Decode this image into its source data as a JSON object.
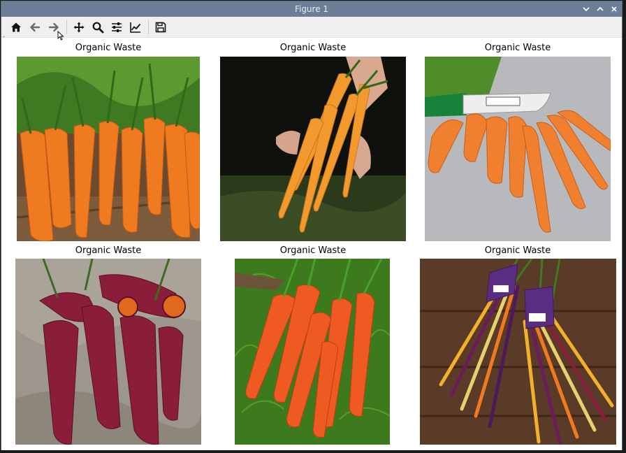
{
  "window": {
    "title": "Figure 1",
    "controls": [
      "chevron-down-icon",
      "chevron-up-icon",
      "close-icon"
    ]
  },
  "toolbar": {
    "buttons": [
      {
        "name": "home",
        "icon": "home-icon"
      },
      {
        "name": "back",
        "icon": "arrow-left-icon"
      },
      {
        "name": "forward",
        "icon": "arrow-right-icon"
      },
      {
        "name": "pan",
        "icon": "move-icon"
      },
      {
        "name": "zoom",
        "icon": "magnifier-icon"
      },
      {
        "name": "subplots",
        "icon": "sliders-icon"
      },
      {
        "name": "edit-axis",
        "icon": "line-chart-icon"
      },
      {
        "name": "save",
        "icon": "floppy-disk-icon"
      }
    ]
  },
  "subplots": [
    {
      "title": "Organic Waste",
      "image": "orange carrots on wooden board"
    },
    {
      "title": "Organic Waste",
      "image": "hand holding bunch of carrots"
    },
    {
      "title": "Organic Waste",
      "image": "carrots with knife on grey surface"
    },
    {
      "title": "Organic Waste",
      "image": "purple-red carrots on stone"
    },
    {
      "title": "Organic Waste",
      "image": "red-orange carrots on green leaves"
    },
    {
      "title": "Organic Waste",
      "image": "rainbow carrot bunches on wood"
    }
  ],
  "colors": {
    "titlebar": "#6d7f96",
    "toolbar": "#efefef",
    "carrot_orange": "#f07a20",
    "carrot_purple": "#8a1d3a"
  }
}
